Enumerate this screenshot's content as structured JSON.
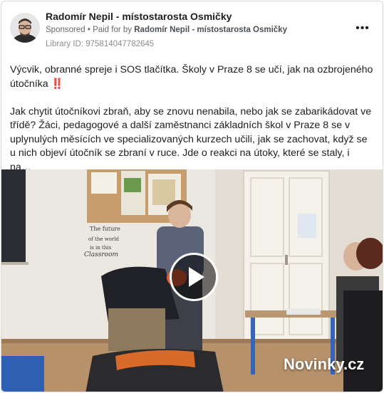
{
  "post": {
    "page_name": "Radomír Nepil - místostarosta Osmičky",
    "sponsored_label": "Sponsored",
    "separator": "•",
    "paid_for_prefix": "Paid for by",
    "paid_for_name": "Radomír Nepil - místostarosta Osmičky",
    "library_id": "Library ID: 975814047782645",
    "more_icon": "more-dots-icon",
    "headline": "Výcvik, obranné spreje i SOS tlačítka. Školy v Praze 8 se učí, jak na ozbrojeného útočníka",
    "headline_emoji": "‼️",
    "body": "Jak chytit útočníkovi zbraň, aby se znovu nenabila, nebo jak se zabarikádovat ve třídě? Žáci, pedagogové a další zaměstnanci základních škol v Praze 8 se v uplynulých měsících ve specializovaných kurzech učili, jak se zachovat, když se u nich objeví útočník se zbraní v ruce. Jde o reakci na útoky, které se staly, i na…"
  },
  "video": {
    "watermark": "Novinky.cz",
    "wall_sign": "The future of the world is in this classroom",
    "play_icon": "play-icon"
  },
  "colors": {
    "accent": "#1c1e21",
    "muted": "#65676b",
    "alert": "#e3324a"
  }
}
